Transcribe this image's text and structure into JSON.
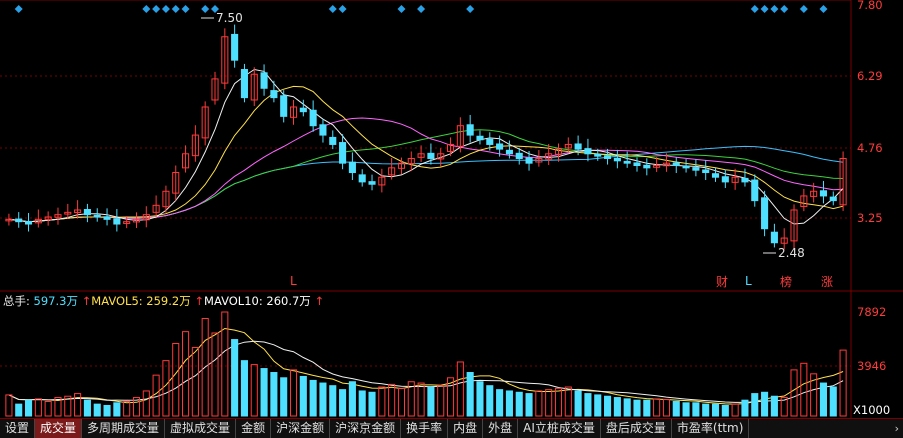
{
  "price_axis": {
    "labels": [
      "7.80",
      "6.29",
      "4.76",
      "3.25"
    ]
  },
  "volume_axis": {
    "labels": [
      "7892",
      "3946",
      "X1000"
    ]
  },
  "annotations": {
    "high_label": "7.50",
    "low_label": "2.48",
    "markers": [
      "L",
      "财",
      "L",
      "榜",
      "涨"
    ]
  },
  "volume_legend": {
    "total_label": "总手:",
    "total_value": "597.3万",
    "arrow": "↑",
    "mavol5_label": "MAVOL5:",
    "mavol5_value": "259.2万",
    "mavol10_label": "MAVOL10:",
    "mavol10_value": "260.7万"
  },
  "tabs": [
    {
      "label": "设置",
      "active": false
    },
    {
      "label": "成交量",
      "active": true
    },
    {
      "label": "多周期成交量",
      "active": false
    },
    {
      "label": "虚拟成交量",
      "active": false
    },
    {
      "label": "金额",
      "active": false
    },
    {
      "label": "沪深金额",
      "active": false
    },
    {
      "label": "沪深京金额",
      "active": false
    },
    {
      "label": "换手率",
      "active": false
    },
    {
      "label": "内盘",
      "active": false
    },
    {
      "label": "外盘",
      "active": false
    },
    {
      "label": "AI立桩成交量",
      "active": false
    },
    {
      "label": "盘后成交量",
      "active": false
    },
    {
      "label": "市盈率(ttm)",
      "active": false
    }
  ],
  "tab_more_icon": "chevron-right-icon",
  "colors": {
    "up": "#ff3b3b",
    "down": "#4fe0ff",
    "grid": "#7a0000",
    "axis_text": "#ff3b3b",
    "background": "#000000"
  },
  "chart_data": [
    {
      "type": "candlestick",
      "title": "",
      "ylim": [
        2.48,
        7.8
      ],
      "grid": true,
      "series": [
        {
          "name": "price",
          "values": [
            3.2,
            3.15,
            3.1,
            3.2,
            3.25,
            3.3,
            3.35,
            3.4,
            3.3,
            3.25,
            3.2,
            3.1,
            3.15,
            3.2,
            3.3,
            3.5,
            3.8,
            4.2,
            4.6,
            5.0,
            5.6,
            6.2,
            7.1,
            6.6,
            5.8,
            6.3,
            6.0,
            5.8,
            5.4,
            5.6,
            5.5,
            5.2,
            5.0,
            4.8,
            4.4,
            4.2,
            4.0,
            3.95,
            4.1,
            4.3,
            4.4,
            4.5,
            4.6,
            4.5,
            4.6,
            4.8,
            5.2,
            5.0,
            4.9,
            4.8,
            4.7,
            4.6,
            4.5,
            4.4,
            4.5,
            4.6,
            4.7,
            4.8,
            4.7,
            4.6,
            4.55,
            4.5,
            4.45,
            4.4,
            4.35,
            4.3,
            4.35,
            4.4,
            4.35,
            4.3,
            4.25,
            4.2,
            4.1,
            4.0,
            4.1,
            4.0,
            3.6,
            3.0,
            2.7,
            2.8,
            3.4,
            3.7,
            3.8,
            3.7,
            3.6,
            4.5
          ]
        }
      ]
    },
    {
      "type": "bar",
      "title": "",
      "ylim": [
        0,
        7892
      ],
      "series": [
        {
          "name": "成交量",
          "values": [
            1600,
            900,
            1200,
            1300,
            1100,
            1400,
            1500,
            1700,
            1200,
            900,
            800,
            1000,
            1100,
            1400,
            1900,
            3100,
            4200,
            5500,
            6400,
            5200,
            7400,
            6300,
            7892,
            5800,
            4200,
            3900,
            3600,
            3300,
            2900,
            3500,
            3000,
            2700,
            2500,
            2300,
            2000,
            2600,
            1900,
            1800,
            2200,
            2400,
            2100,
            2600,
            2500,
            2200,
            2300,
            2900,
            4100,
            3300,
            2600,
            2300,
            2000,
            1900,
            1800,
            1700,
            1900,
            2000,
            2100,
            2200,
            1900,
            1700,
            1600,
            1500,
            1400,
            1300,
            1200,
            1200,
            1300,
            1250,
            1100,
            1000,
            1000,
            900,
            900,
            800,
            900,
            1200,
            1700,
            1800,
            1500,
            1400,
            3500,
            4000,
            3200,
            2500,
            2200,
            5000
          ]
        }
      ]
    }
  ]
}
